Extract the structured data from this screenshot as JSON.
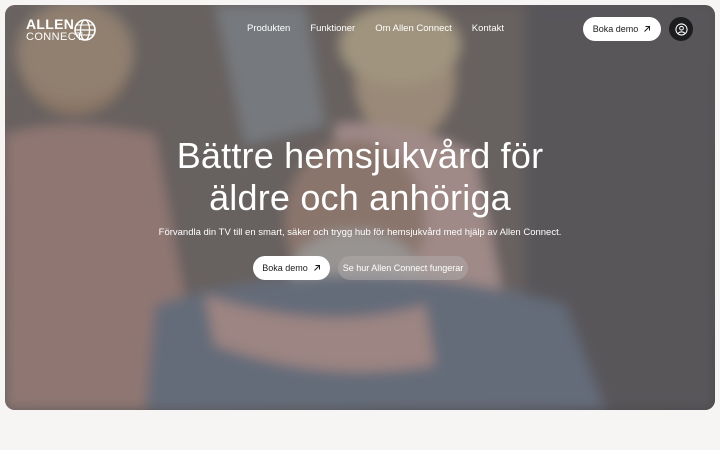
{
  "brand": {
    "line1": "ALLEN",
    "line2": "CONNECT"
  },
  "nav": {
    "links": [
      "Produkten",
      "Funktioner",
      "Om Allen Connect",
      "Kontakt"
    ],
    "cta_label": "Boka demo"
  },
  "hero": {
    "headline_line1": "Bättre hemsjukvård för",
    "headline_line2": "äldre och anhöriga",
    "subtitle": "Förvandla din TV till en smart, säker och trygg hub för hemsjukvård med hjälp av Allen Connect.",
    "primary_button": "Boka demo",
    "secondary_button": "Se hur Allen Connect fungerar"
  },
  "icons": [
    "globe-icon",
    "arrow-up-right-icon",
    "user-circle-icon"
  ],
  "colors": {
    "page_bg": "#f6f5f3",
    "button_bg": "#ffffff",
    "user_button_bg": "#1d1d1f"
  }
}
